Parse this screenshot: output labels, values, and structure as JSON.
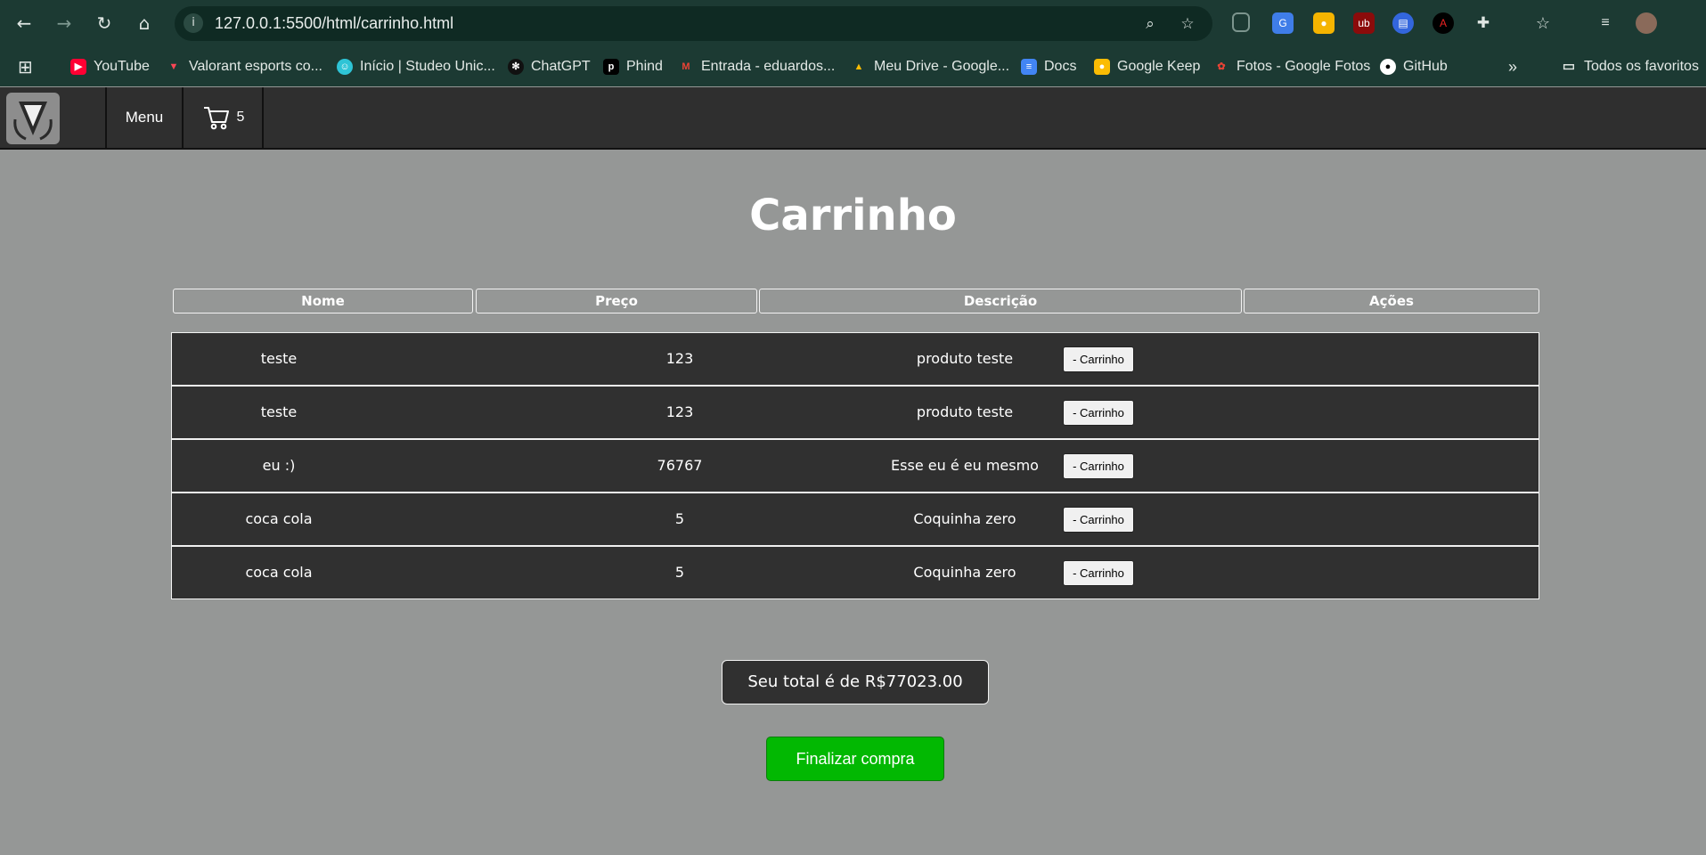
{
  "browser": {
    "url": "127.0.0.1:5500/html/carrinho.html",
    "bookmarks": [
      {
        "label": "YouTube",
        "icon": "youtube-icon",
        "color": "#ff0033"
      },
      {
        "label": "Valorant esports co...",
        "icon": "valorant-icon",
        "color": "#ff4655"
      },
      {
        "label": "Início | Studeo Unic...",
        "icon": "studeo-icon",
        "color": "#2ec4d6"
      },
      {
        "label": "ChatGPT",
        "icon": "chatgpt-icon",
        "color": "#111111"
      },
      {
        "label": "Phind",
        "icon": "phind-icon",
        "color": "#000000"
      },
      {
        "label": "Entrada - eduardos...",
        "icon": "gmail-icon",
        "color": "#ea4335"
      },
      {
        "label": "Meu Drive - Google...",
        "icon": "google-drive-icon",
        "color": "#1fa463"
      },
      {
        "label": "Docs",
        "icon": "google-docs-icon",
        "color": "#4285f4"
      },
      {
        "label": "Google Keep",
        "icon": "google-keep-icon",
        "color": "#fbbc04"
      },
      {
        "label": "Fotos - Google Fotos",
        "icon": "google-photos-icon",
        "color": "#ea4335"
      },
      {
        "label": "GitHub",
        "icon": "github-icon",
        "color": "#ffffff"
      }
    ],
    "all_bookmarks_label": "Todos os favoritos"
  },
  "site_nav": {
    "menu_label": "Menu",
    "cart_count": "5"
  },
  "page": {
    "title": "Carrinho"
  },
  "table": {
    "headers": [
      "Nome",
      "Preço",
      "Descrição",
      "Ações"
    ],
    "rows": [
      {
        "nome": "teste",
        "preco": "123",
        "descricao": "produto teste",
        "acao": "- Carrinho"
      },
      {
        "nome": "teste",
        "preco": "123",
        "descricao": "produto teste",
        "acao": "- Carrinho"
      },
      {
        "nome": "eu :)",
        "preco": "76767",
        "descricao": "Esse eu é eu mesmo",
        "acao": "- Carrinho"
      },
      {
        "nome": "coca cola",
        "preco": "5",
        "descricao": "Coquinha zero",
        "acao": "- Carrinho"
      },
      {
        "nome": "coca cola",
        "preco": "5",
        "descricao": "Coquinha zero",
        "acao": "- Carrinho"
      }
    ]
  },
  "summary": {
    "total_text": "Seu total é de R$77023.00",
    "checkout_label": "Finalizar compra"
  },
  "colors": {
    "page_background": "#959796",
    "navbar": "#2f2f2f",
    "checkout_green": "#02b802"
  }
}
